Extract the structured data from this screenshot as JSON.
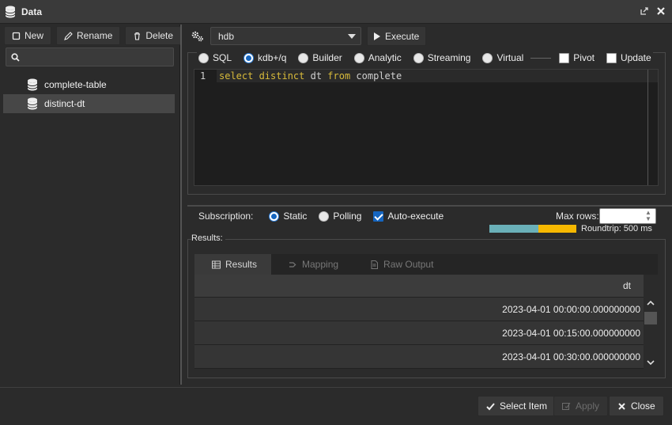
{
  "window": {
    "title": "Data",
    "popout_icon": "popout-icon",
    "close_icon": "close-icon"
  },
  "left_toolbar": {
    "new_label": "New",
    "rename_label": "Rename",
    "delete_label": "Delete"
  },
  "search": {
    "placeholder": "",
    "value": ""
  },
  "tree": {
    "items": [
      {
        "label": "complete-table",
        "selected": false,
        "icon": "database-icon"
      },
      {
        "label": "distinct-dt",
        "selected": true,
        "icon": "database-icon"
      }
    ]
  },
  "query": {
    "connection": "hdb",
    "execute_label": "Execute",
    "modes": [
      "SQL",
      "kdb+/q",
      "Builder",
      "Analytic",
      "Streaming",
      "Virtual"
    ],
    "selected_mode": "kdb+/q",
    "pivot_label": "Pivot",
    "pivot_checked": false,
    "update_label": "Update",
    "update_checked": false,
    "editor": {
      "line_number": "1",
      "tokens": [
        {
          "text": "select distinct",
          "kind": "keyword"
        },
        {
          "text": " dt ",
          "kind": "ident"
        },
        {
          "text": "from",
          "kind": "keyword"
        },
        {
          "text": " complete",
          "kind": "ident"
        }
      ]
    }
  },
  "subscription": {
    "label": "Subscription:",
    "options": [
      "Static",
      "Polling"
    ],
    "selected": "Static",
    "auto_execute_label": "Auto-execute",
    "auto_execute_checked": true,
    "max_rows_label": "Max rows:",
    "max_rows_value": "",
    "roundtrip_label": "Roundtrip: 500 ms"
  },
  "results": {
    "group_label": "Results:",
    "tabs": [
      {
        "label": "Results",
        "active": true,
        "icon": "table-icon"
      },
      {
        "label": "Mapping",
        "active": false,
        "icon": "mapping-icon"
      },
      {
        "label": "Raw Output",
        "active": false,
        "icon": "document-icon"
      }
    ],
    "column": "dt",
    "rows": [
      "2023-04-01 00:00:00.000000000",
      "2023-04-01 00:15:00.000000000",
      "2023-04-01 00:30:00.000000000"
    ]
  },
  "footer": {
    "select_item_label": "Select Item",
    "apply_label": "Apply",
    "close_label": "Close"
  },
  "colors": {
    "accent": "#1565c0",
    "keyword": "#d7ba3a",
    "roundtrip_a": "#6ab0b8",
    "roundtrip_b": "#f6b800"
  }
}
